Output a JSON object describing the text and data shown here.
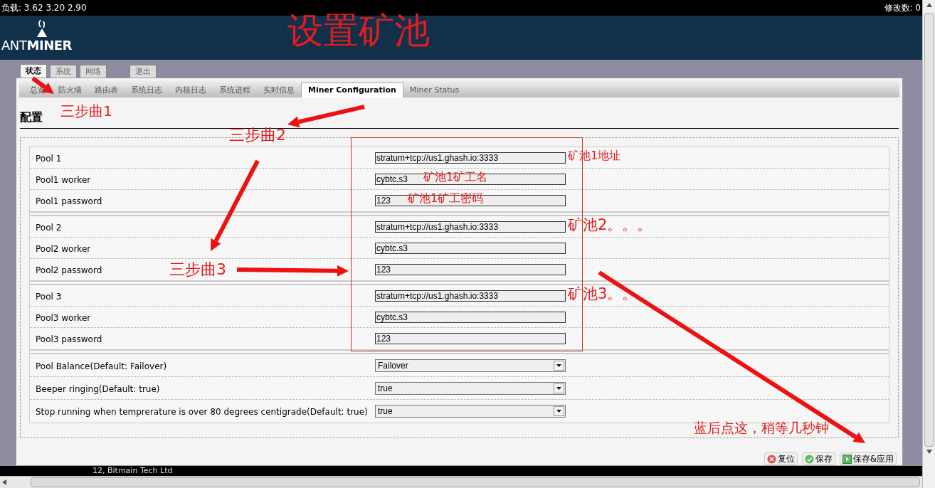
{
  "status_bar": {
    "load": "负载: 3.62 3.20 2.90",
    "changes": "修改数: 0"
  },
  "logo": {
    "light": "ANT",
    "bold": "MINER"
  },
  "main_tabs": [
    {
      "label": "状态",
      "kind": "tab",
      "selected": true
    },
    {
      "label": "系统",
      "kind": "tab",
      "selected": false
    },
    {
      "label": "网络",
      "kind": "tab",
      "selected": false
    },
    {
      "label": "退出",
      "kind": "logout",
      "selected": false
    }
  ],
  "sub_tabs": [
    {
      "label": "总览",
      "selected": false
    },
    {
      "label": "防火墙",
      "selected": false
    },
    {
      "label": "路由表",
      "selected": false
    },
    {
      "label": "系统日志",
      "selected": false
    },
    {
      "label": "内核日志",
      "selected": false
    },
    {
      "label": "系统进程",
      "selected": false
    },
    {
      "label": "实时信息",
      "selected": false
    },
    {
      "label": "Miner Configuration",
      "selected": true
    },
    {
      "label": "Miner Status",
      "selected": false
    }
  ],
  "section_title": "配置",
  "pools": [
    {
      "fields": [
        {
          "label": "Pool 1",
          "value": "stratum+tcp://us1.ghash.io:3333"
        },
        {
          "label": "Pool1 worker",
          "value": "cybtc.s3"
        },
        {
          "label": "Pool1 password",
          "value": "123"
        }
      ]
    },
    {
      "fields": [
        {
          "label": "Pool 2",
          "value": "stratum+tcp://us1.ghash.io:3333"
        },
        {
          "label": "Pool2 worker",
          "value": "cybtc.s3"
        },
        {
          "label": "Pool2 password",
          "value": "123"
        }
      ]
    },
    {
      "fields": [
        {
          "label": "Pool 3",
          "value": "stratum+tcp://us1.ghash.io:3333"
        },
        {
          "label": "Pool3 worker",
          "value": "cybtc.s3"
        },
        {
          "label": "Pool3 password",
          "value": "123"
        }
      ]
    }
  ],
  "settings": [
    {
      "label": "Pool Balance(Default: Failover)",
      "value": "Failover"
    },
    {
      "label": "Beeper ringing(Default: true)",
      "value": "true"
    },
    {
      "label": "Stop running when temprerature is over 80 degrees centigrade(Default: true)",
      "value": "true"
    }
  ],
  "buttons": [
    {
      "label": "复位",
      "kind": "reset"
    },
    {
      "label": "保存",
      "kind": "save"
    },
    {
      "label": "保存&应用",
      "kind": "apply"
    }
  ],
  "footer": "12, Bitmain Tech Ltd",
  "annotations": [
    {
      "text": "设置矿池"
    },
    {
      "text": "三步曲1"
    },
    {
      "text": "三步曲2"
    },
    {
      "text": "三步曲3"
    },
    {
      "text": "矿池1地址"
    },
    {
      "text": "矿池1矿工名"
    },
    {
      "text": "矿池1矿工密码"
    },
    {
      "text": "矿池2。。。"
    },
    {
      "text": "矿池3。。。"
    },
    {
      "text": "蓝后点这，稍等几秒钟"
    }
  ]
}
